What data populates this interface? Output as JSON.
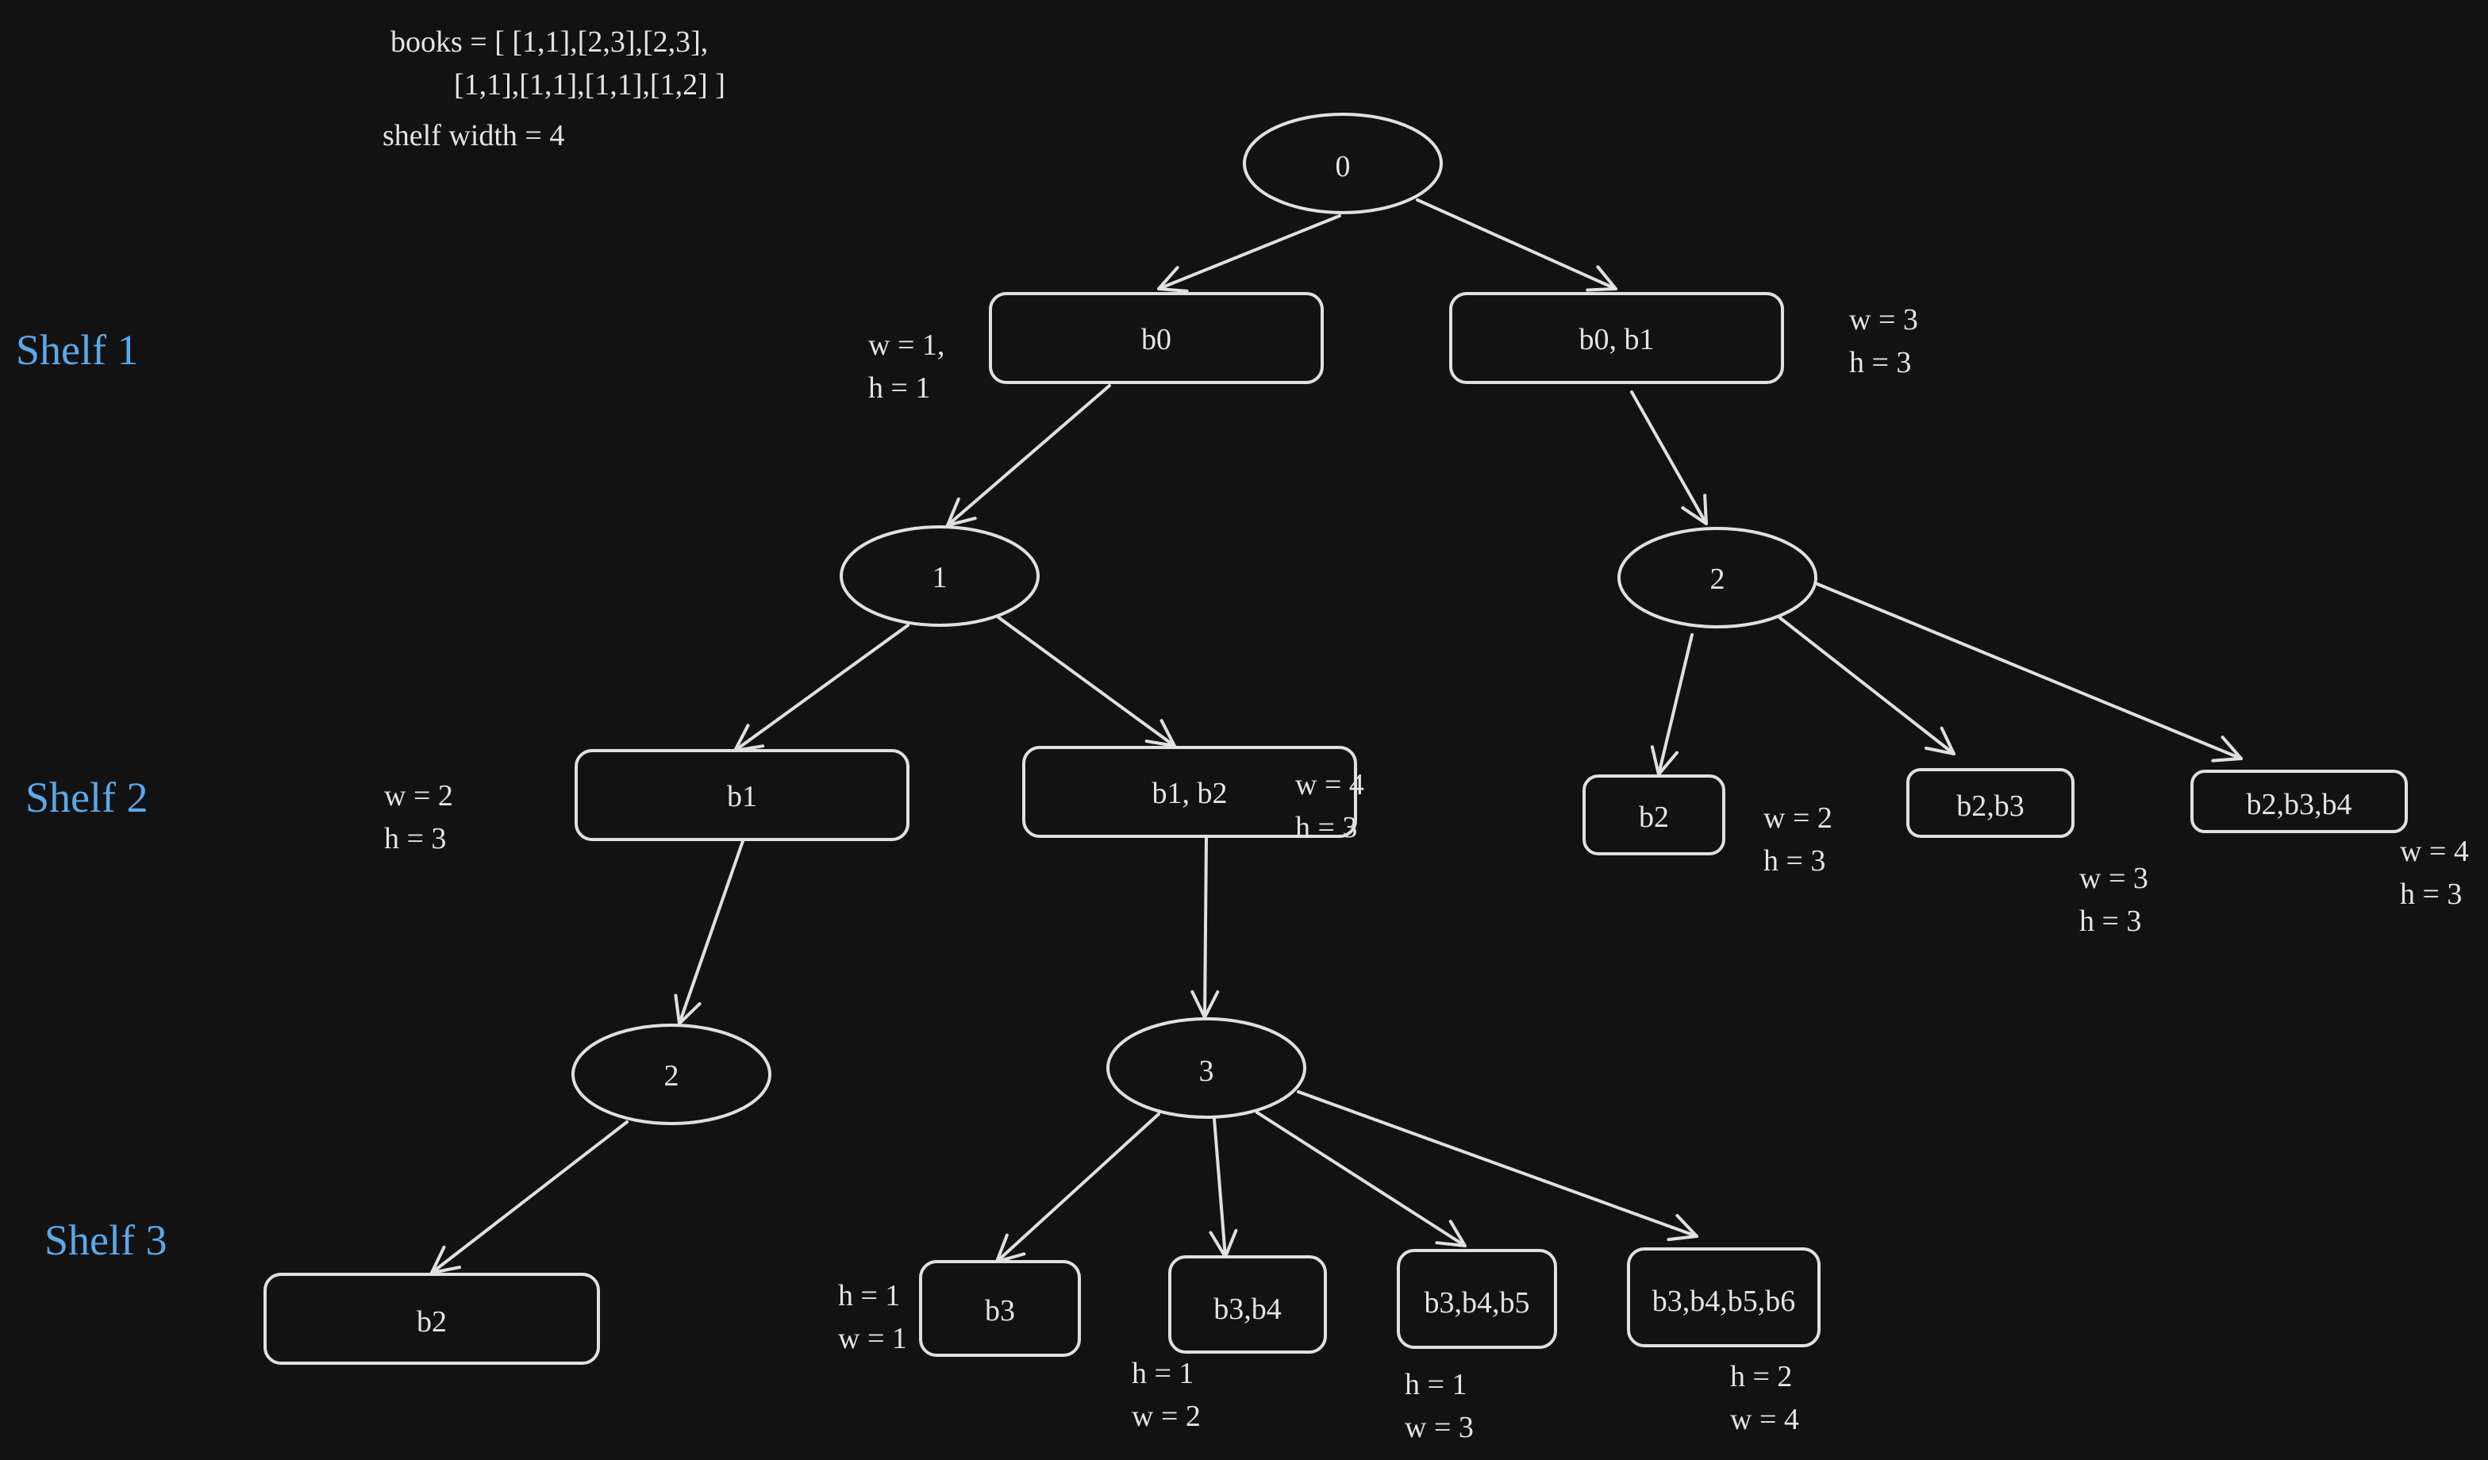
{
  "header": {
    "books_line1": "books = [ [1,1],[2,3],[2,3],",
    "books_line2": "[1,1],[1,1],[1,1],[1,2] ]",
    "shelf_width": "shelf width = 4"
  },
  "shelves": [
    "Shelf 1",
    "Shelf 2",
    "Shelf 3"
  ],
  "colors": {
    "background": "#121212",
    "stroke": "#e0e0e0",
    "shelf_label": "#5aa9ea"
  },
  "nodes": [
    {
      "id": "s0",
      "type": "state",
      "label": "0"
    },
    {
      "id": "c_b0",
      "type": "choice",
      "label": "b0"
    },
    {
      "id": "c_b0b1",
      "type": "choice",
      "label": "b0, b1"
    },
    {
      "id": "s1",
      "type": "state",
      "label": "1"
    },
    {
      "id": "s2a",
      "type": "state",
      "label": "2"
    },
    {
      "id": "c_b1",
      "type": "choice",
      "label": "b1"
    },
    {
      "id": "c_b1b2",
      "type": "choice",
      "label": "b1, b2"
    },
    {
      "id": "c_b2r",
      "type": "choice",
      "label": "b2"
    },
    {
      "id": "c_b2b3",
      "type": "choice",
      "label": "b2,b3"
    },
    {
      "id": "c_b2b3b4",
      "type": "choice",
      "label": "b2,b3,b4"
    },
    {
      "id": "s2b",
      "type": "state",
      "label": "2"
    },
    {
      "id": "s3",
      "type": "state",
      "label": "3"
    },
    {
      "id": "c_b2l",
      "type": "choice",
      "label": "b2"
    },
    {
      "id": "c_b3",
      "type": "choice",
      "label": "b3"
    },
    {
      "id": "c_b3b4",
      "type": "choice",
      "label": "b3,b4"
    },
    {
      "id": "c_b3b4b5",
      "type": "choice",
      "label": "b3,b4,b5"
    },
    {
      "id": "c_b3b4b5b6",
      "type": "choice",
      "label": "b3,b4,b5,b6"
    }
  ],
  "annotations": [
    {
      "for": "b0",
      "line1": "w = 1,",
      "line2": "h = 1"
    },
    {
      "for": "b0, b1",
      "line1": "w = 3",
      "line2": "h = 3"
    },
    {
      "for": "b1",
      "line1": "w = 2",
      "line2": "h = 3"
    },
    {
      "for": "b1, b2",
      "line1": "w = 4",
      "line2": "h = 3"
    },
    {
      "for": "b2",
      "line1": "w = 2",
      "line2": "h = 3"
    },
    {
      "for": "b2,b3",
      "line1": "w = 3",
      "line2": "h = 3"
    },
    {
      "for": "b2,b3,b4",
      "line1": "w = 4",
      "line2": "h = 3"
    },
    {
      "for": "b3",
      "line1": "h = 1",
      "line2": "w = 1"
    },
    {
      "for": "b3,b4",
      "line1": "h = 1",
      "line2": "w = 2"
    },
    {
      "for": "b3,b4,b5",
      "line1": "h = 1",
      "line2": "w = 3"
    },
    {
      "for": "b3,b4,b5,b6",
      "line1": "h = 2",
      "line2": "w = 4"
    }
  ]
}
